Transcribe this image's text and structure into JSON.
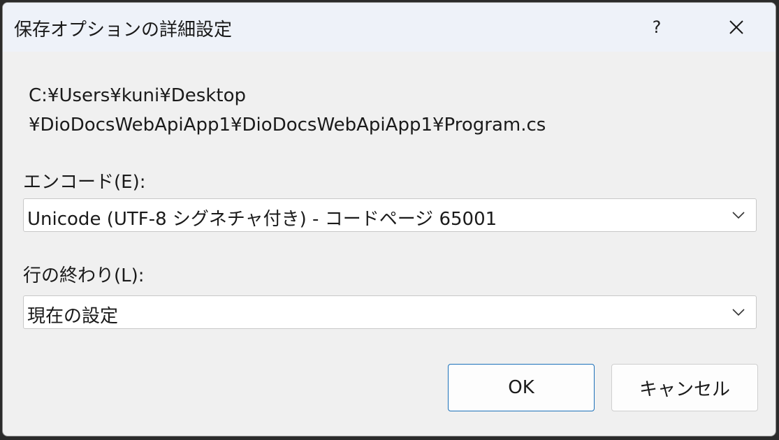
{
  "dialog": {
    "title": "保存オプションの詳細設定",
    "help_label": "?",
    "close_icon": "close-icon"
  },
  "file_path": {
    "line1": "C:¥Users¥kuni¥Desktop",
    "line2": "¥DioDocsWebApiApp1¥DioDocsWebApiApp1¥Program.cs"
  },
  "encoding": {
    "label": "エンコード(E):",
    "selected": "Unicode (UTF-8 シグネチャ付き) - コードページ 65001",
    "icon": "chevron-down-icon"
  },
  "line_endings": {
    "label": "行の終わり(L):",
    "selected": "現在の設定",
    "icon": "chevron-down-icon"
  },
  "buttons": {
    "ok_label": "OK",
    "cancel_label": "キャンセル"
  },
  "colors": {
    "titlebar_bg": "#eef2f9",
    "dialog_bg": "#f0f0f0",
    "ok_border": "#1a6fb8"
  }
}
